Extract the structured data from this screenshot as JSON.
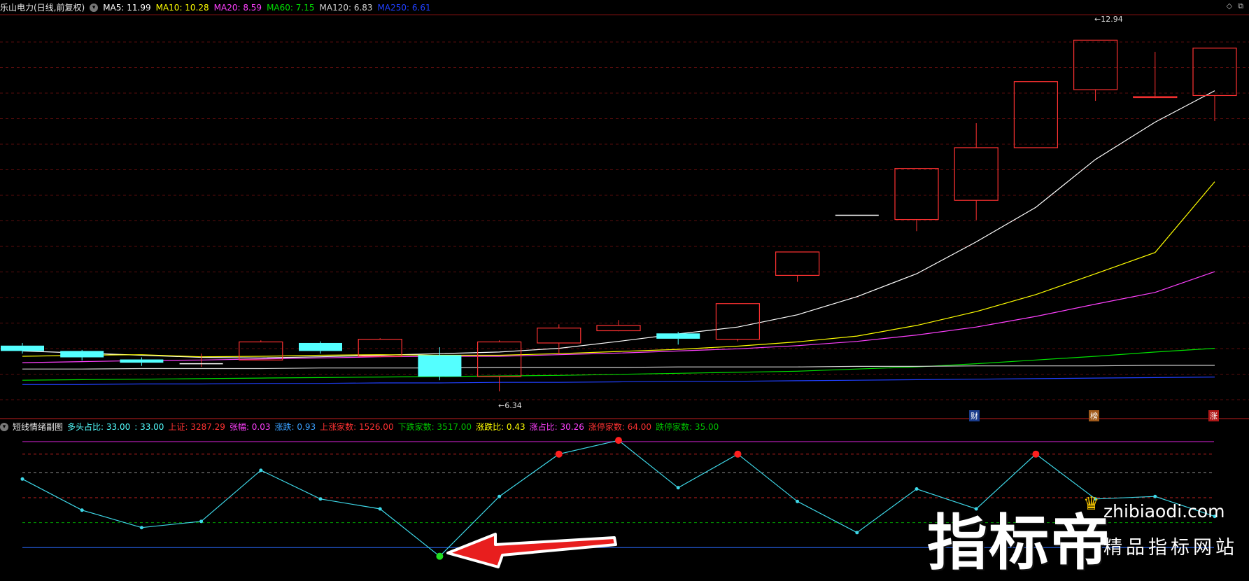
{
  "main_header": {
    "title": "乐山电力(日线,前复权)",
    "ma5": "MA5: 11.99",
    "ma10": "MA10: 10.28",
    "ma20": "MA20: 8.59",
    "ma60": "MA60: 7.15",
    "ma120": "MA120: 6.83",
    "ma250": "MA250: 6.61"
  },
  "sub_header": {
    "title": "短线情绪副图",
    "duotou": "多头占比: 33.00",
    "duotou2": ": 33.00",
    "shangzheng": "上证: 3287.29",
    "zhangfu": "张幅: 0.03",
    "zhangdie": "涨跌: 0.93",
    "shangzhang": "上涨家数: 1526.00",
    "xiadie": "下跌家数: 3517.00",
    "zhangdiebi": "涨跌比: 0.43",
    "zhangzhanbi": "涨占比: 30.26",
    "zhangting": "涨停家数: 64.00",
    "dieting": "跌停家数: 35.00"
  },
  "annotations": {
    "high": "12.94",
    "low": "6.34"
  },
  "event_tags": {
    "cai": "财",
    "bang": "榜",
    "zhang": "涨"
  },
  "watermark": {
    "brand": "指标帝",
    "domain": "zhibiaodi.com",
    "slogan": "精品指标网站"
  },
  "colors": {
    "up": "#ff3232",
    "down": "#54ffff",
    "ma5": "#ffffff",
    "ma10": "#ffff00",
    "ma20": "#ff40ff",
    "ma60": "#00e000",
    "ma120": "#d0d0d0",
    "ma250": "#2040ff"
  },
  "chart_data": [
    {
      "type": "candlestick",
      "title": "乐山电力(日线,前复权)",
      "price_range": [
        6.0,
        13.3
      ],
      "candles": [
        {
          "open": 7.2,
          "close": 7.1,
          "high": 7.25,
          "low": 7.05
        },
        {
          "open": 7.1,
          "close": 6.98,
          "high": 7.12,
          "low": 6.92
        },
        {
          "open": 6.94,
          "close": 6.88,
          "high": 6.98,
          "low": 6.82
        },
        {
          "open": 6.86,
          "close": 6.86,
          "high": 7.05,
          "low": 6.8
        },
        {
          "open": 6.93,
          "close": 7.27,
          "high": 7.3,
          "low": 6.93
        },
        {
          "open": 7.25,
          "close": 7.1,
          "high": 7.28,
          "low": 7.05
        },
        {
          "open": 7.0,
          "close": 7.32,
          "high": 7.34,
          "low": 6.98
        },
        {
          "open": 7.02,
          "close": 6.62,
          "high": 7.17,
          "low": 6.55
        },
        {
          "open": 6.62,
          "close": 7.27,
          "high": 7.3,
          "low": 6.34
        },
        {
          "open": 7.25,
          "close": 7.53,
          "high": 7.6,
          "low": 7.04
        },
        {
          "open": 7.48,
          "close": 7.58,
          "high": 7.68,
          "low": 7.47
        },
        {
          "open": 7.43,
          "close": 7.33,
          "high": 7.46,
          "low": 7.22
        },
        {
          "open": 7.32,
          "close": 7.99,
          "high": 7.99,
          "low": 7.28
        },
        {
          "open": 8.52,
          "close": 8.96,
          "high": 8.96,
          "low": 8.4
        },
        {
          "open": 9.65,
          "close": 9.65,
          "high": 9.65,
          "low": 9.65
        },
        {
          "open": 9.57,
          "close": 10.53,
          "high": 10.53,
          "low": 9.35
        },
        {
          "open": 9.93,
          "close": 10.92,
          "high": 11.38,
          "low": 9.56
        },
        {
          "open": 10.92,
          "close": 12.16,
          "high": 12.16,
          "low": 10.92
        },
        {
          "open": 12.01,
          "close": 12.94,
          "high": 12.94,
          "low": 11.8
        },
        {
          "open": 11.86,
          "close": 11.88,
          "high": 12.72,
          "low": 11.85
        },
        {
          "open": 11.9,
          "close": 12.79,
          "high": 12.79,
          "low": 11.42
        }
      ],
      "ma_series": [
        {
          "name": "MA5",
          "values": [
            7.1,
            7.06,
            7.02,
            6.98,
            6.97,
            6.99,
            7.02,
            7.05,
            7.08,
            7.15,
            7.28,
            7.42,
            7.55,
            7.78,
            8.12,
            8.55,
            9.15,
            9.8,
            10.7,
            11.4,
            11.99
          ]
        },
        {
          "name": "MA10",
          "values": [
            7.0,
            7.02,
            7.03,
            6.99,
            7.0,
            7.02,
            7.03,
            7.02,
            7.02,
            7.05,
            7.09,
            7.13,
            7.19,
            7.27,
            7.38,
            7.58,
            7.84,
            8.16,
            8.55,
            8.95,
            10.28
          ]
        },
        {
          "name": "MA20",
          "values": [
            6.88,
            6.9,
            6.92,
            6.93,
            6.95,
            6.97,
            6.99,
            7.0,
            7.0,
            7.03,
            7.06,
            7.1,
            7.14,
            7.2,
            7.28,
            7.4,
            7.55,
            7.75,
            7.98,
            8.2,
            8.59
          ]
        },
        {
          "name": "MA60",
          "values": [
            6.55,
            6.56,
            6.57,
            6.58,
            6.59,
            6.6,
            6.61,
            6.62,
            6.63,
            6.64,
            6.66,
            6.68,
            6.7,
            6.72,
            6.76,
            6.8,
            6.86,
            6.93,
            7.0,
            7.08,
            7.15
          ]
        },
        {
          "name": "MA120",
          "values": [
            6.76,
            6.76,
            6.77,
            6.77,
            6.77,
            6.78,
            6.78,
            6.78,
            6.79,
            6.79,
            6.79,
            6.8,
            6.8,
            6.8,
            6.81,
            6.81,
            6.82,
            6.82,
            6.82,
            6.83,
            6.83
          ]
        },
        {
          "name": "MA250",
          "values": [
            6.47,
            6.47,
            6.48,
            6.48,
            6.49,
            6.49,
            6.5,
            6.5,
            6.51,
            6.51,
            6.52,
            6.53,
            6.53,
            6.54,
            6.55,
            6.56,
            6.57,
            6.58,
            6.59,
            6.6,
            6.61
          ]
        }
      ]
    },
    {
      "type": "line",
      "title": "短线情绪副图",
      "ylim": [
        0,
        100
      ],
      "reference_lines": [
        95,
        85,
        70,
        50,
        30,
        10
      ],
      "values": [
        65,
        40,
        26,
        31,
        72,
        49,
        41,
        3,
        51,
        85,
        96,
        58,
        85,
        47,
        22,
        57,
        41,
        85,
        49,
        51,
        35
      ]
    }
  ]
}
